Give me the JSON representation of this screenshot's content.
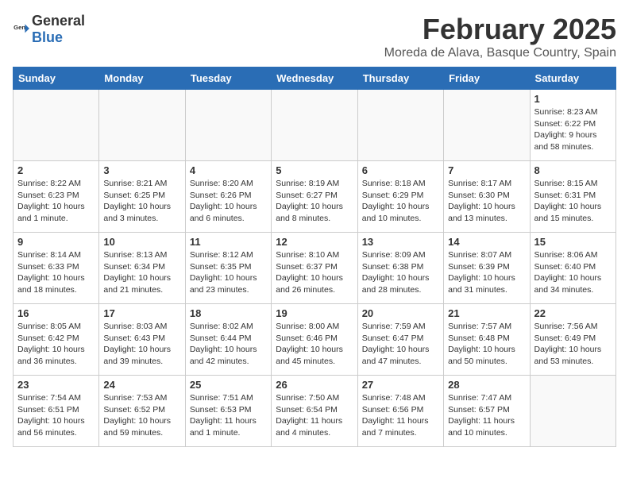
{
  "logo": {
    "general": "General",
    "blue": "Blue"
  },
  "header": {
    "title": "February 2025",
    "subtitle": "Moreda de Alava, Basque Country, Spain"
  },
  "weekdays": [
    "Sunday",
    "Monday",
    "Tuesday",
    "Wednesday",
    "Thursday",
    "Friday",
    "Saturday"
  ],
  "weeks": [
    [
      {
        "day": "",
        "info": ""
      },
      {
        "day": "",
        "info": ""
      },
      {
        "day": "",
        "info": ""
      },
      {
        "day": "",
        "info": ""
      },
      {
        "day": "",
        "info": ""
      },
      {
        "day": "",
        "info": ""
      },
      {
        "day": "1",
        "info": "Sunrise: 8:23 AM\nSunset: 6:22 PM\nDaylight: 9 hours\nand 58 minutes."
      }
    ],
    [
      {
        "day": "2",
        "info": "Sunrise: 8:22 AM\nSunset: 6:23 PM\nDaylight: 10 hours\nand 1 minute."
      },
      {
        "day": "3",
        "info": "Sunrise: 8:21 AM\nSunset: 6:25 PM\nDaylight: 10 hours\nand 3 minutes."
      },
      {
        "day": "4",
        "info": "Sunrise: 8:20 AM\nSunset: 6:26 PM\nDaylight: 10 hours\nand 6 minutes."
      },
      {
        "day": "5",
        "info": "Sunrise: 8:19 AM\nSunset: 6:27 PM\nDaylight: 10 hours\nand 8 minutes."
      },
      {
        "day": "6",
        "info": "Sunrise: 8:18 AM\nSunset: 6:29 PM\nDaylight: 10 hours\nand 10 minutes."
      },
      {
        "day": "7",
        "info": "Sunrise: 8:17 AM\nSunset: 6:30 PM\nDaylight: 10 hours\nand 13 minutes."
      },
      {
        "day": "8",
        "info": "Sunrise: 8:15 AM\nSunset: 6:31 PM\nDaylight: 10 hours\nand 15 minutes."
      }
    ],
    [
      {
        "day": "9",
        "info": "Sunrise: 8:14 AM\nSunset: 6:33 PM\nDaylight: 10 hours\nand 18 minutes."
      },
      {
        "day": "10",
        "info": "Sunrise: 8:13 AM\nSunset: 6:34 PM\nDaylight: 10 hours\nand 21 minutes."
      },
      {
        "day": "11",
        "info": "Sunrise: 8:12 AM\nSunset: 6:35 PM\nDaylight: 10 hours\nand 23 minutes."
      },
      {
        "day": "12",
        "info": "Sunrise: 8:10 AM\nSunset: 6:37 PM\nDaylight: 10 hours\nand 26 minutes."
      },
      {
        "day": "13",
        "info": "Sunrise: 8:09 AM\nSunset: 6:38 PM\nDaylight: 10 hours\nand 28 minutes."
      },
      {
        "day": "14",
        "info": "Sunrise: 8:07 AM\nSunset: 6:39 PM\nDaylight: 10 hours\nand 31 minutes."
      },
      {
        "day": "15",
        "info": "Sunrise: 8:06 AM\nSunset: 6:40 PM\nDaylight: 10 hours\nand 34 minutes."
      }
    ],
    [
      {
        "day": "16",
        "info": "Sunrise: 8:05 AM\nSunset: 6:42 PM\nDaylight: 10 hours\nand 36 minutes."
      },
      {
        "day": "17",
        "info": "Sunrise: 8:03 AM\nSunset: 6:43 PM\nDaylight: 10 hours\nand 39 minutes."
      },
      {
        "day": "18",
        "info": "Sunrise: 8:02 AM\nSunset: 6:44 PM\nDaylight: 10 hours\nand 42 minutes."
      },
      {
        "day": "19",
        "info": "Sunrise: 8:00 AM\nSunset: 6:46 PM\nDaylight: 10 hours\nand 45 minutes."
      },
      {
        "day": "20",
        "info": "Sunrise: 7:59 AM\nSunset: 6:47 PM\nDaylight: 10 hours\nand 47 minutes."
      },
      {
        "day": "21",
        "info": "Sunrise: 7:57 AM\nSunset: 6:48 PM\nDaylight: 10 hours\nand 50 minutes."
      },
      {
        "day": "22",
        "info": "Sunrise: 7:56 AM\nSunset: 6:49 PM\nDaylight: 10 hours\nand 53 minutes."
      }
    ],
    [
      {
        "day": "23",
        "info": "Sunrise: 7:54 AM\nSunset: 6:51 PM\nDaylight: 10 hours\nand 56 minutes."
      },
      {
        "day": "24",
        "info": "Sunrise: 7:53 AM\nSunset: 6:52 PM\nDaylight: 10 hours\nand 59 minutes."
      },
      {
        "day": "25",
        "info": "Sunrise: 7:51 AM\nSunset: 6:53 PM\nDaylight: 11 hours\nand 1 minute."
      },
      {
        "day": "26",
        "info": "Sunrise: 7:50 AM\nSunset: 6:54 PM\nDaylight: 11 hours\nand 4 minutes."
      },
      {
        "day": "27",
        "info": "Sunrise: 7:48 AM\nSunset: 6:56 PM\nDaylight: 11 hours\nand 7 minutes."
      },
      {
        "day": "28",
        "info": "Sunrise: 7:47 AM\nSunset: 6:57 PM\nDaylight: 11 hours\nand 10 minutes."
      },
      {
        "day": "",
        "info": ""
      }
    ]
  ]
}
